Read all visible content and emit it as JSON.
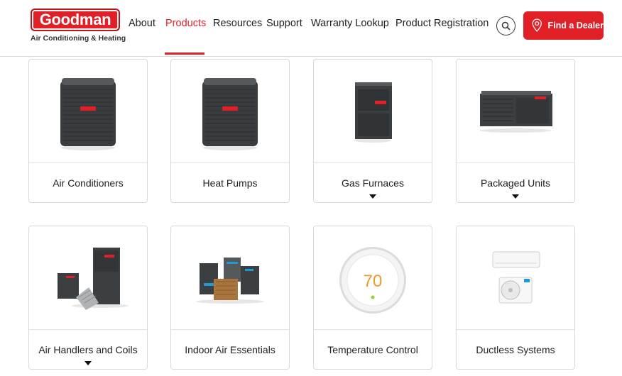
{
  "brand": {
    "name": "Goodman",
    "tagline": "Air Conditioning & Heating",
    "color": "#e01f26"
  },
  "nav": {
    "items": [
      {
        "label": "About",
        "active": false
      },
      {
        "label": "Products",
        "active": true
      },
      {
        "label": "Resources",
        "active": false
      },
      {
        "label": "Support",
        "active": false
      },
      {
        "label": "Warranty Lookup",
        "active": false
      },
      {
        "label": "Product Registration",
        "active": false
      }
    ],
    "search_icon": "search-icon",
    "dealer_button": {
      "label": "Find a Dealer",
      "icon": "map-pin-icon"
    }
  },
  "products": [
    {
      "label": "Air Conditioners",
      "has_dropdown": false,
      "icon": "condenser-unit"
    },
    {
      "label": "Heat Pumps",
      "has_dropdown": false,
      "icon": "condenser-unit"
    },
    {
      "label": "Gas Furnaces",
      "has_dropdown": true,
      "icon": "furnace"
    },
    {
      "label": "Packaged Units",
      "has_dropdown": true,
      "icon": "packaged-unit"
    },
    {
      "label": "Air Handlers and Coils",
      "has_dropdown": true,
      "icon": "air-handler"
    },
    {
      "label": "Indoor Air Essentials",
      "has_dropdown": false,
      "icon": "air-quality-products"
    },
    {
      "label": "Temperature Control",
      "has_dropdown": false,
      "icon": "thermostat",
      "thermostat_reading": "70"
    },
    {
      "label": "Ductless Systems",
      "has_dropdown": false,
      "icon": "mini-split"
    }
  ]
}
